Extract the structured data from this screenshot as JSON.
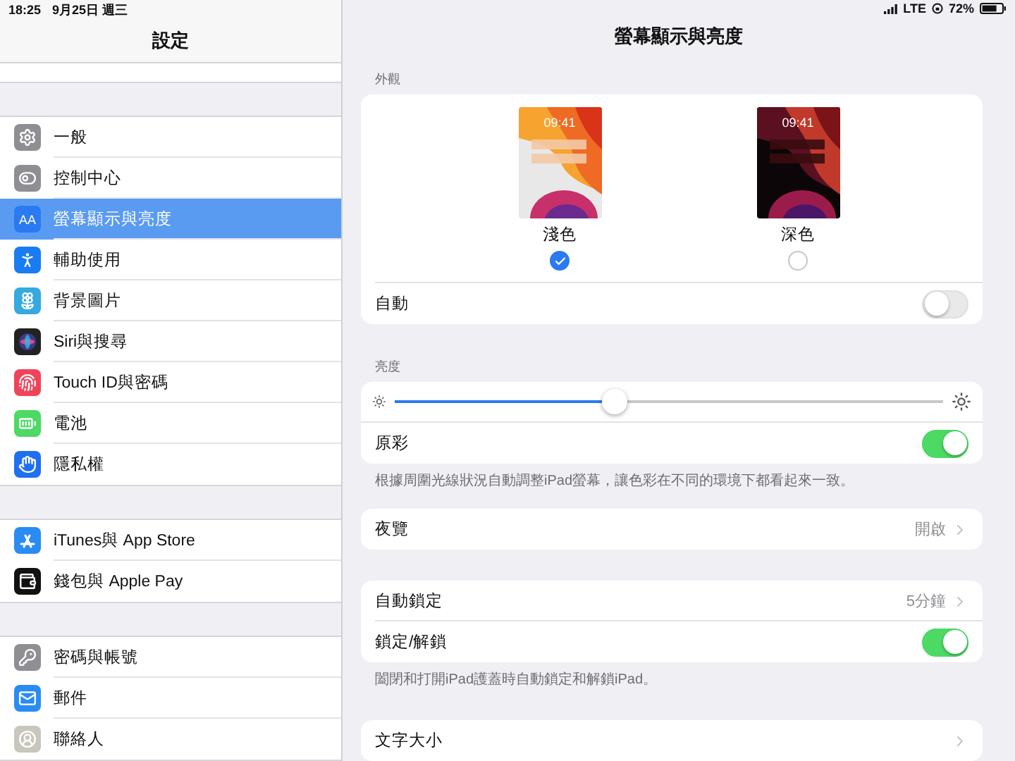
{
  "status_bar": {
    "time": "18:25",
    "date": "9月25日 週三",
    "network": "LTE",
    "battery": "72%"
  },
  "sidebar": {
    "title": "設定",
    "sections": [
      {
        "items": [
          {
            "label": "一般",
            "selected": false
          },
          {
            "label": "控制中心",
            "selected": false
          },
          {
            "label": "螢幕顯示與亮度",
            "selected": true,
            "icon_text": "AA"
          },
          {
            "label": "輔助使用",
            "selected": false
          },
          {
            "label": "背景圖片",
            "selected": false
          },
          {
            "label": "Siri與搜尋",
            "selected": false
          },
          {
            "label": "Touch ID與密碼",
            "selected": false
          },
          {
            "label": "電池",
            "selected": false
          },
          {
            "label": "隱私權",
            "selected": false
          }
        ]
      },
      {
        "items": [
          {
            "label": "iTunes與 App Store",
            "selected": false
          },
          {
            "label": "錢包與 Apple Pay",
            "selected": false
          }
        ]
      },
      {
        "items": [
          {
            "label": "密碼與帳號",
            "selected": false
          },
          {
            "label": "郵件",
            "selected": false
          },
          {
            "label": "聯絡人",
            "selected": false
          }
        ]
      }
    ]
  },
  "detail": {
    "title": "螢幕顯示與亮度",
    "appearance": {
      "header": "外觀",
      "options": [
        {
          "label": "淺色",
          "time": "09:41",
          "kind": "light",
          "selected": true
        },
        {
          "label": "深色",
          "time": "09:41",
          "kind": "dark",
          "selected": false
        }
      ],
      "automatic": {
        "label": "自動",
        "on": false
      }
    },
    "brightness": {
      "header": "亮度",
      "level": 0.4,
      "true_tone": {
        "label": "原彩",
        "on": true
      },
      "footer": "根據周圍光線狀況自動調整iPad螢幕，讓色彩在不同的環境下都看起來一致。"
    },
    "groups": [
      {
        "rows": [
          {
            "kind": "link",
            "label": "夜覽",
            "value": "開啟"
          }
        ]
      },
      {
        "rows": [
          {
            "kind": "link",
            "label": "自動鎖定",
            "value": "5分鐘"
          },
          {
            "kind": "toggle",
            "label": "鎖定/解鎖",
            "on": true
          }
        ],
        "footer": "闔閉和打開iPad護蓋時自動鎖定和解鎖iPad。"
      },
      {
        "rows": [
          {
            "kind": "link",
            "label": "文字大小"
          }
        ]
      }
    ]
  }
}
